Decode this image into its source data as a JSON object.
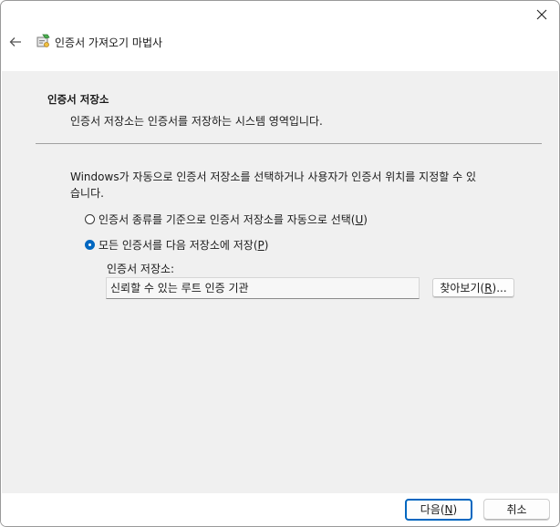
{
  "window": {
    "title": "인증서 가져오기 마법사",
    "close_icon": "close-icon",
    "back_icon": "back-arrow-icon",
    "wizard_icon": "certificate-wizard-icon"
  },
  "header": {
    "title": "인증서 저장소",
    "description": "인증서 저장소는 인증서를 저장하는 시스템 영역입니다."
  },
  "body": {
    "intro_line1": "Windows가 자동으로 인증서 저장소를 선택하거나 사용자가 인증서 위치를 지정할 수 있",
    "intro_line2": "습니다.",
    "option_auto": {
      "label": "인증서 종류를 기준으로 인증서 저장소를 자동으로 선택(",
      "key": "U",
      "suffix": ")",
      "checked": false
    },
    "option_manual": {
      "label": "모든 인증서를 다음 저장소에 저장(",
      "key": "P",
      "suffix": ")",
      "checked": true
    },
    "store_label": "인증서 저장소:",
    "store_value": "신뢰할 수 있는 루트 인증 기관",
    "browse": {
      "label": "찾아보기(",
      "key": "R",
      "suffix": ")..."
    }
  },
  "footer": {
    "next": {
      "label": "다음(",
      "key": "N",
      "suffix": ")"
    },
    "cancel": "취소"
  },
  "colors": {
    "accent": "#0067c0",
    "content_bg": "#f0f0f0"
  }
}
